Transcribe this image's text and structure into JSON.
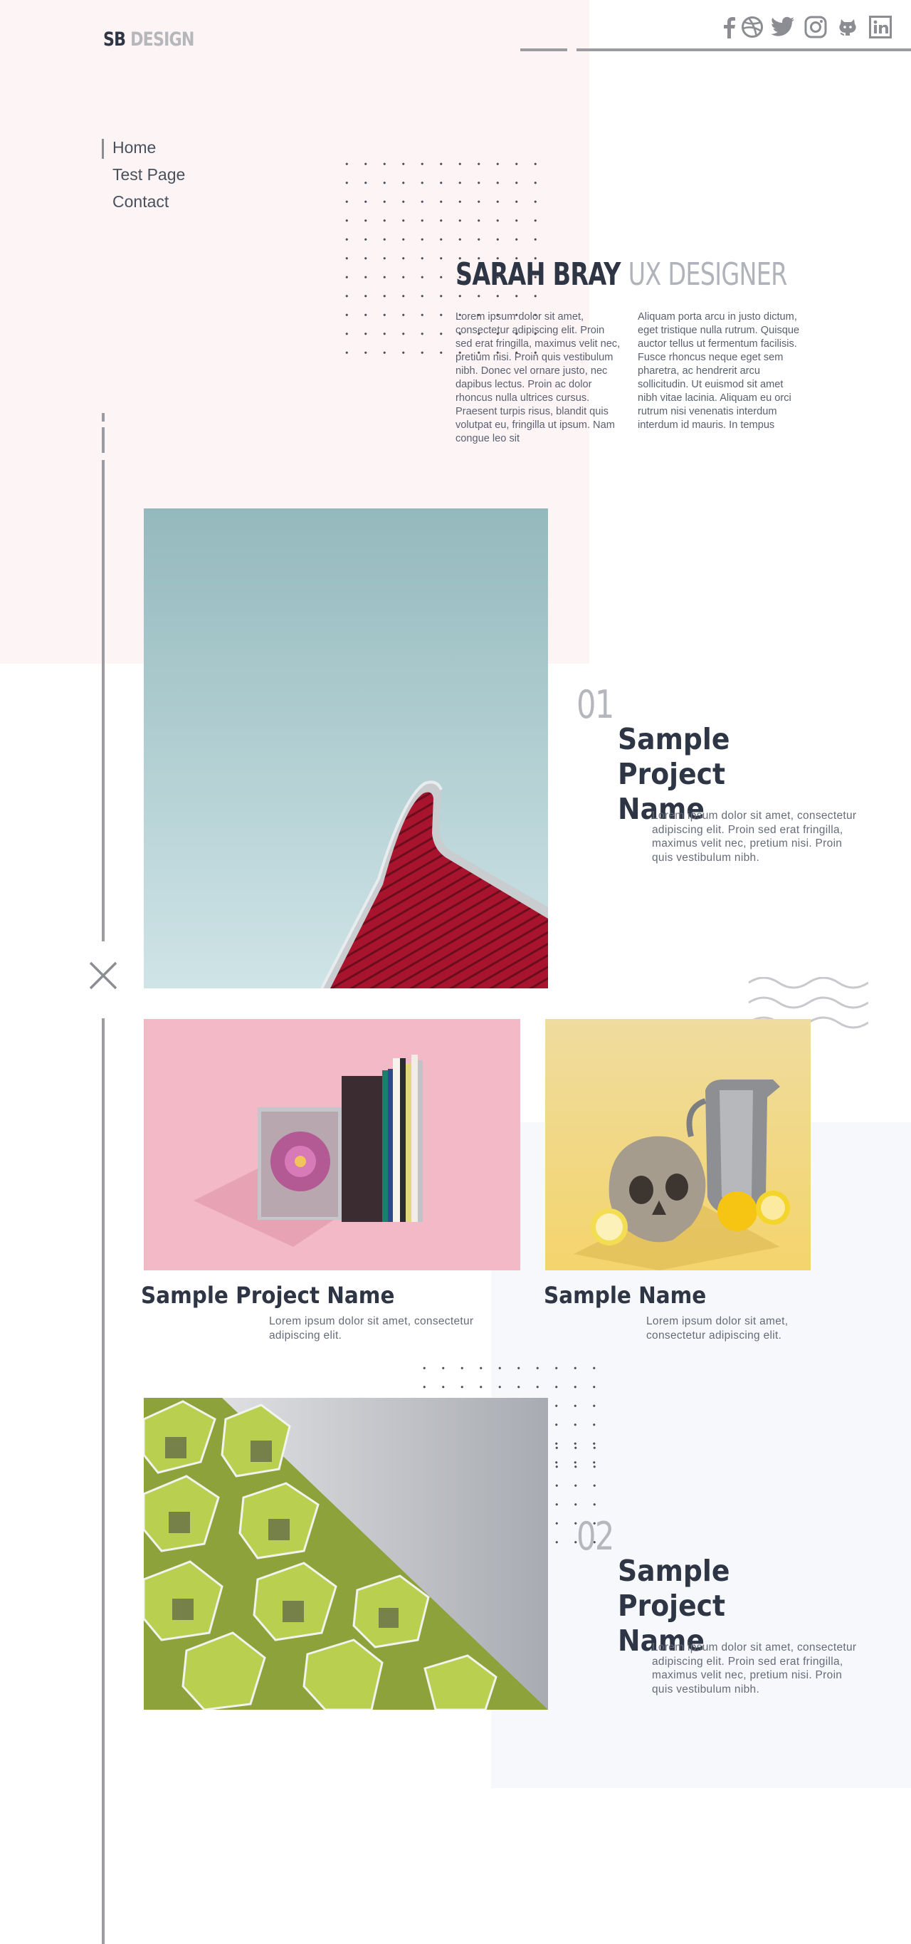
{
  "header": {
    "logo_primary": "SB",
    "logo_secondary": "DESIGN",
    "social": [
      {
        "name": "facebook-icon"
      },
      {
        "name": "dribbble-icon"
      },
      {
        "name": "twitter-icon"
      },
      {
        "name": "instagram-icon"
      },
      {
        "name": "github-icon"
      },
      {
        "name": "linkedin-icon"
      }
    ]
  },
  "nav": {
    "items": [
      {
        "label": "Home",
        "active": true
      },
      {
        "label": "Test Page",
        "active": false
      },
      {
        "label": "Contact",
        "active": false
      }
    ]
  },
  "hero": {
    "name": "SARAH BRAY",
    "role": "UX DESIGNER",
    "col1": "Lorem ipsum dolor sit amet, consectetur adipiscing elit. Proin sed erat fringilla, maximus velit nec, pretium nisi. Proin quis vestibulum nibh. Donec vel ornare justo, nec dapibus lectus. Proin ac dolor rhoncus nulla ultrices cursus. Praesent turpis risus, blandit quis volutpat eu, fringilla ut ipsum. Nam congue leo sit",
    "col2": "Aliquam porta arcu in justo dictum, eget tristique nulla rutrum. Quisque auctor tellus ut fermentum facilisis. Fusce rhoncus neque eget sem pharetra, ac hendrerit arcu sollicitudin. Ut euismod sit amet nibh vitae lacinia. Aliquam eu orci rutrum nisi venenatis interdum interdum id mauris. In tempus"
  },
  "projects": {
    "featured1": {
      "number": "01",
      "name": "Sample Project Name",
      "description": "Lorem ipsum dolor sit amet, consectetur adipiscing elit. Proin sed erat fringilla, maximus velit nec, pretium nisi. Proin quis vestibulum nibh."
    },
    "small1": {
      "name": "Sample Project Name",
      "description": "Lorem ipsum dolor sit amet, consectetur adipiscing elit."
    },
    "small2": {
      "name": "Sample Name",
      "description": "Lorem ipsum dolor sit amet, consectetur adipiscing elit."
    },
    "featured2": {
      "number": "02",
      "name": "Sample Project Name",
      "description": "Lorem ipsum dolor sit amet, consectetur adipiscing elit. Proin sed erat fringilla, maximus velit nec, pretium nisi. Proin quis vestibulum nibh."
    }
  },
  "colors": {
    "text_dark": "#2e3544",
    "text_muted": "#b6b7bb",
    "bg_pink": "#fdf5f5",
    "bg_lavender": "#f7f8fc",
    "rule_gray": "#9a9ca1"
  }
}
